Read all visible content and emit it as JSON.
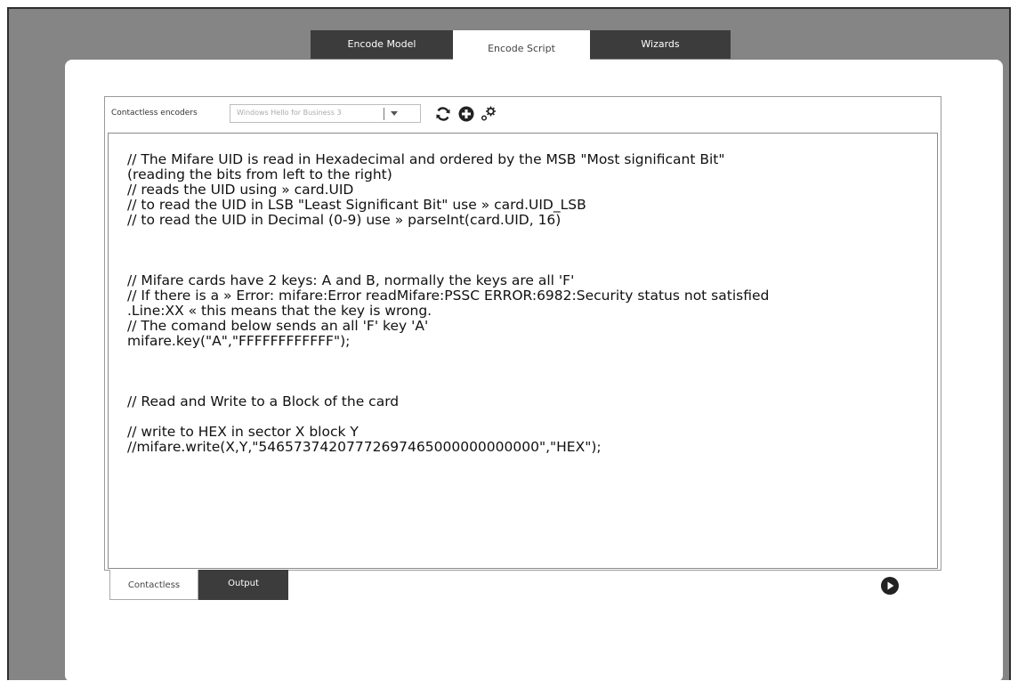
{
  "top_tabs": [
    {
      "label": "Encode Model",
      "active": false
    },
    {
      "label": "Encode Script",
      "active": true
    },
    {
      "label": "Wizards",
      "active": false
    }
  ],
  "toolbar": {
    "label": "Contactless encoders",
    "encoder_select_value": "Windows Hello for Business 3",
    "icons": [
      "refresh-icon",
      "add-icon",
      "settings-icon"
    ]
  },
  "script_text": "// The Mifare UID is read in Hexadecimal and ordered by the MSB \"Most significant Bit\"\n(reading the bits from left to the right)\n// reads the UID using » card.UID\n// to read the UID in LSB \"Least Significant Bit\" use » card.UID_LSB\n// to read the UID in Decimal (0-9) use » parseInt(card.UID, 16)\n\n\n\n// Mifare cards have 2 keys: A and B, normally the keys are all 'F'\n// If there is a » Error: mifare:Error readMifare:PSSC ERROR:6982:Security status not satisfied\n.Line:XX « this means that the key is wrong.\n// The comand below sends an all 'F' key 'A'\nmifare.key(\"A\",\"FFFFFFFFFFFF\");\n\n\n\n// Read and Write to a Block of the card\n\n// write to HEX in sector X block Y\n//mifare.write(X,Y,\"54657374207772697465000000000000\",\"HEX\");",
  "bottom_tabs": [
    {
      "label": "Contactless",
      "active": true
    },
    {
      "label": "Output",
      "active": false
    }
  ],
  "colors": {
    "window_bg": "#858585",
    "tab_dark": "#3c3c3c",
    "panel_bg": "#ffffff",
    "text": "#111111"
  }
}
